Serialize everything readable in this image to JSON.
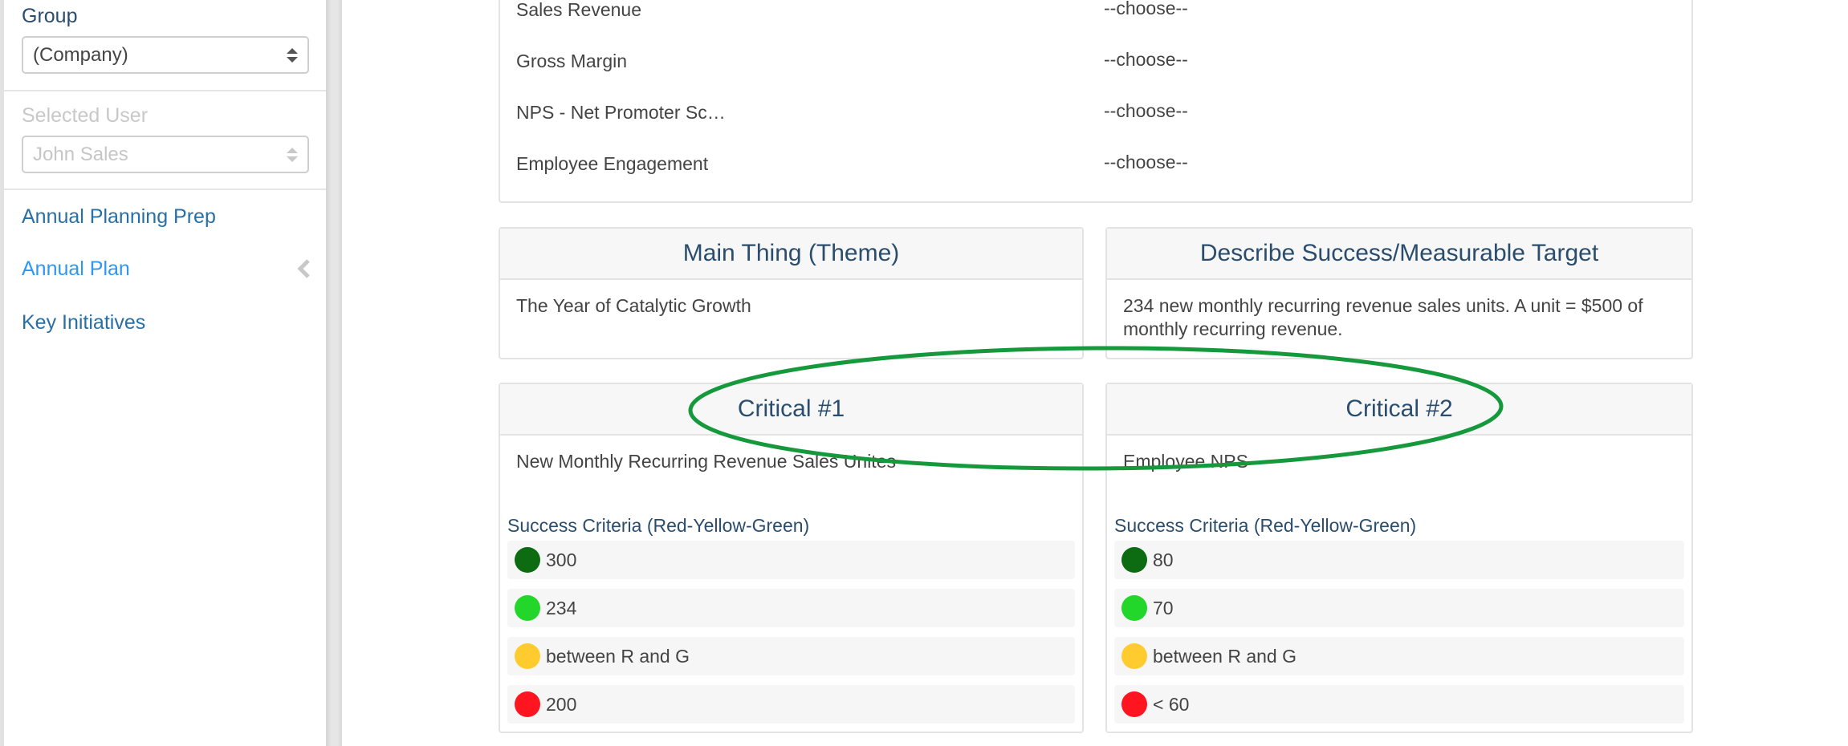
{
  "sidebar": {
    "group_label": "Group",
    "group_select": {
      "value": "(Company)"
    },
    "user_label": "Selected User",
    "user_select": {
      "value": "John Sales"
    },
    "nav": [
      {
        "label": "Annual Planning Prep",
        "active": false
      },
      {
        "label": "Annual Plan",
        "active": true,
        "icon": "chevron-left-icon"
      },
      {
        "label": "Key Initiatives",
        "active": false
      }
    ]
  },
  "kpis": [
    {
      "name": "Sales Revenue",
      "value": "--choose--"
    },
    {
      "name": "Gross Margin",
      "value": "--choose--"
    },
    {
      "name": "NPS - Net Promoter Sc…",
      "value": "--choose--"
    },
    {
      "name": "Employee Engagement",
      "value": "--choose--"
    }
  ],
  "main_thing": {
    "title": "Main Thing (Theme)",
    "body": "The Year of Catalytic Growth"
  },
  "success_target": {
    "title": "Describe Success/Measurable Target",
    "body": "234 new monthly recurring revenue sales units. A unit = $500 of monthly recurring revenue."
  },
  "criticals": [
    {
      "title": "Critical #1",
      "body": "New Monthly Recurring Revenue Sales Unites",
      "criteria_label": "Success Criteria (Red-Yellow-Green)",
      "criteria": [
        {
          "level": "dark-green",
          "color": "#0d6b12",
          "text": "300"
        },
        {
          "level": "green",
          "color": "#22d62a",
          "text": "234"
        },
        {
          "level": "yellow",
          "color": "#ffcb2f",
          "text": "between R and G"
        },
        {
          "level": "red",
          "color": "#ff1520",
          "text": "200"
        }
      ]
    },
    {
      "title": "Critical #2",
      "body": "Employee NPS",
      "criteria_label": "Success Criteria (Red-Yellow-Green)",
      "criteria": [
        {
          "level": "dark-green",
          "color": "#0d6b12",
          "text": "80"
        },
        {
          "level": "green",
          "color": "#22d62a",
          "text": "70"
        },
        {
          "level": "yellow",
          "color": "#ffcb2f",
          "text": "between R and G"
        },
        {
          "level": "red",
          "color": "#ff1520",
          "text": "< 60"
        }
      ]
    }
  ],
  "annotation": {
    "shape": "ellipse",
    "color": "#16993c",
    "highlights": "Critical #1, Critical #2 headers"
  }
}
